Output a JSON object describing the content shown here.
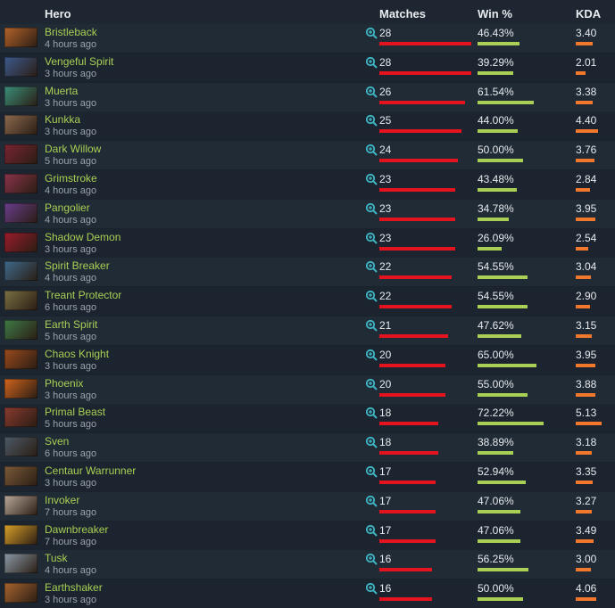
{
  "header": {
    "hero": "Hero",
    "matches": "Matches",
    "win": "Win %",
    "kda": "KDA"
  },
  "icons": {
    "zoom": "magnifier-plus-icon"
  },
  "colors": {
    "hero_name": "#a9cf54",
    "matches_bar": "#e3141f",
    "win_bar": "#a9cf54",
    "kda_bar": "#f2782b",
    "zoom_icon": "#3fb7c6"
  },
  "scales": {
    "matches_max": 28,
    "win_max_percent": 100,
    "kda_max": 5.13
  },
  "rows": [
    {
      "hero": "Bristleback",
      "time": "4 hours ago",
      "matches": "28",
      "matches_value": 28,
      "win": "46.43%",
      "win_value": 46.43,
      "kda": "3.40",
      "kda_value": 3.4,
      "avatar_color": "#b5632a"
    },
    {
      "hero": "Vengeful Spirit",
      "time": "3 hours ago",
      "matches": "28",
      "matches_value": 28,
      "win": "39.29%",
      "win_value": 39.29,
      "kda": "2.01",
      "kda_value": 2.01,
      "avatar_color": "#3d5a8e"
    },
    {
      "hero": "Muerta",
      "time": "3 hours ago",
      "matches": "26",
      "matches_value": 26,
      "win": "61.54%",
      "win_value": 61.54,
      "kda": "3.38",
      "kda_value": 3.38,
      "avatar_color": "#3a8f7a"
    },
    {
      "hero": "Kunkka",
      "time": "3 hours ago",
      "matches": "25",
      "matches_value": 25,
      "win": "44.00%",
      "win_value": 44.0,
      "kda": "4.40",
      "kda_value": 4.4,
      "avatar_color": "#8c6a4e"
    },
    {
      "hero": "Dark Willow",
      "time": "5 hours ago",
      "matches": "24",
      "matches_value": 24,
      "win": "50.00%",
      "win_value": 50.0,
      "kda": "3.76",
      "kda_value": 3.76,
      "avatar_color": "#7a2432"
    },
    {
      "hero": "Grimstroke",
      "time": "4 hours ago",
      "matches": "23",
      "matches_value": 23,
      "win": "43.48%",
      "win_value": 43.48,
      "kda": "2.84",
      "kda_value": 2.84,
      "avatar_color": "#8a3348"
    },
    {
      "hero": "Pangolier",
      "time": "4 hours ago",
      "matches": "23",
      "matches_value": 23,
      "win": "34.78%",
      "win_value": 34.78,
      "kda": "3.95",
      "kda_value": 3.95,
      "avatar_color": "#6a3d8c"
    },
    {
      "hero": "Shadow Demon",
      "time": "3 hours ago",
      "matches": "23",
      "matches_value": 23,
      "win": "26.09%",
      "win_value": 26.09,
      "kda": "2.54",
      "kda_value": 2.54,
      "avatar_color": "#9a1c2a"
    },
    {
      "hero": "Spirit Breaker",
      "time": "4 hours ago",
      "matches": "22",
      "matches_value": 22,
      "win": "54.55%",
      "win_value": 54.55,
      "kda": "3.04",
      "kda_value": 3.04,
      "avatar_color": "#3e6a8c"
    },
    {
      "hero": "Treant Protector",
      "time": "6 hours ago",
      "matches": "22",
      "matches_value": 22,
      "win": "54.55%",
      "win_value": 54.55,
      "kda": "2.90",
      "kda_value": 2.9,
      "avatar_color": "#7a7044"
    },
    {
      "hero": "Earth Spirit",
      "time": "5 hours ago",
      "matches": "21",
      "matches_value": 21,
      "win": "47.62%",
      "win_value": 47.62,
      "kda": "3.15",
      "kda_value": 3.15,
      "avatar_color": "#3e7a46"
    },
    {
      "hero": "Chaos Knight",
      "time": "3 hours ago",
      "matches": "20",
      "matches_value": 20,
      "win": "65.00%",
      "win_value": 65.0,
      "kda": "3.95",
      "kda_value": 3.95,
      "avatar_color": "#9a4a1c"
    },
    {
      "hero": "Phoenix",
      "time": "3 hours ago",
      "matches": "20",
      "matches_value": 20,
      "win": "55.00%",
      "win_value": 55.0,
      "kda": "3.88",
      "kda_value": 3.88,
      "avatar_color": "#d1641c"
    },
    {
      "hero": "Primal Beast",
      "time": "5 hours ago",
      "matches": "18",
      "matches_value": 18,
      "win": "72.22%",
      "win_value": 72.22,
      "kda": "5.13",
      "kda_value": 5.13,
      "avatar_color": "#8a3a2e"
    },
    {
      "hero": "Sven",
      "time": "6 hours ago",
      "matches": "18",
      "matches_value": 18,
      "win": "38.89%",
      "win_value": 38.89,
      "kda": "3.18",
      "kda_value": 3.18,
      "avatar_color": "#4c5a66"
    },
    {
      "hero": "Centaur Warrunner",
      "time": "3 hours ago",
      "matches": "17",
      "matches_value": 17,
      "win": "52.94%",
      "win_value": 52.94,
      "kda": "3.35",
      "kda_value": 3.35,
      "avatar_color": "#7a5a38"
    },
    {
      "hero": "Invoker",
      "time": "7 hours ago",
      "matches": "17",
      "matches_value": 17,
      "win": "47.06%",
      "win_value": 47.06,
      "kda": "3.27",
      "kda_value": 3.27,
      "avatar_color": "#b8a89a"
    },
    {
      "hero": "Dawnbreaker",
      "time": "7 hours ago",
      "matches": "17",
      "matches_value": 17,
      "win": "47.06%",
      "win_value": 47.06,
      "kda": "3.49",
      "kda_value": 3.49,
      "avatar_color": "#d9a02a"
    },
    {
      "hero": "Tusk",
      "time": "4 hours ago",
      "matches": "16",
      "matches_value": 16,
      "win": "56.25%",
      "win_value": 56.25,
      "kda": "3.00",
      "kda_value": 3.0,
      "avatar_color": "#8a9aa6"
    },
    {
      "hero": "Earthshaker",
      "time": "3 hours ago",
      "matches": "16",
      "matches_value": 16,
      "win": "50.00%",
      "win_value": 50.0,
      "kda": "4.06",
      "kda_value": 4.06,
      "avatar_color": "#a8642e"
    }
  ]
}
